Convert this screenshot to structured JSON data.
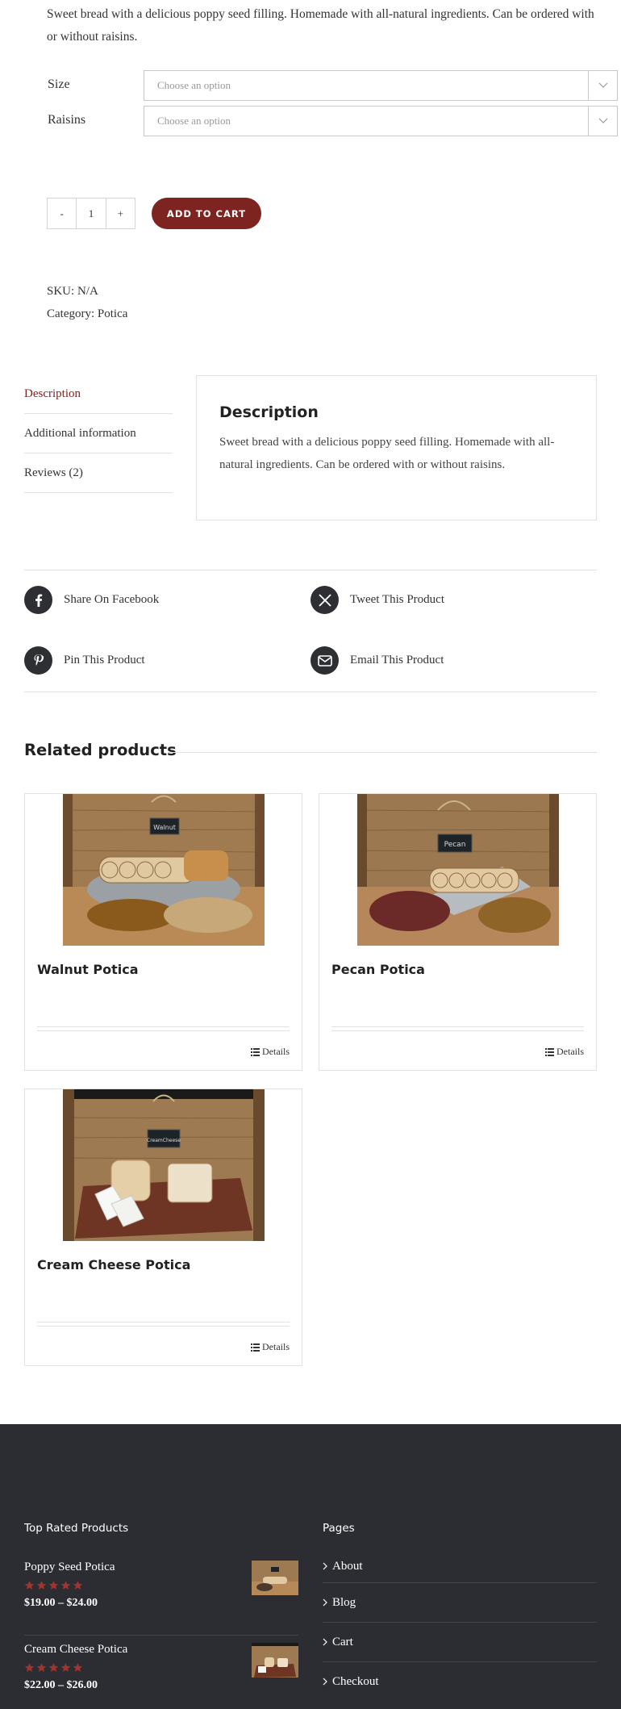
{
  "product": {
    "short_description": "Sweet bread with a delicious poppy seed filling. Homemade with all-natural ingredients. Can be ordered with or without raisins.",
    "variations": [
      {
        "label": "Size",
        "placeholder": "Choose an option"
      },
      {
        "label": "Raisins",
        "placeholder": "Choose an option"
      }
    ],
    "quantity": {
      "minus": "-",
      "value": "1",
      "plus": "+"
    },
    "add_to_cart": "ADD TO CART",
    "sku_label": "SKU:",
    "sku_value": "N/A",
    "category_label": "Category:",
    "category_value": "Potica"
  },
  "tabs": {
    "items": [
      "Description",
      "Additional information",
      "Reviews (2)"
    ],
    "active": "Description",
    "panel_title": "Description",
    "panel_text": "Sweet bread with a delicious poppy seed filling. Homemade with all-natural ingredients. Can be ordered with or without raisins."
  },
  "share": {
    "facebook": "Share On Facebook",
    "twitter": "Tweet This Product",
    "pinterest": "Pin This Product",
    "email": "Email This Product"
  },
  "related": {
    "title": "Related products",
    "products": [
      {
        "name": "Walnut Potica",
        "details": "Details",
        "sign": "Walnut"
      },
      {
        "name": "Pecan Potica",
        "details": "Details",
        "sign": "Pecan"
      },
      {
        "name": "Cream Cheese Potica",
        "details": "Details",
        "sign": "CreamCheese"
      }
    ]
  },
  "footer": {
    "top_rated_title": "Top Rated Products",
    "top_rated": [
      {
        "name": "Poppy Seed Potica",
        "price": "$19.00 – $24.00",
        "rating": 5
      },
      {
        "name": "Cream Cheese Potica",
        "price": "$22.00 – $26.00",
        "rating": 5
      }
    ],
    "pages_title": "Pages",
    "pages": [
      "About",
      "Blog",
      "Cart",
      "Checkout"
    ]
  },
  "colors": {
    "accent": "#7d2320",
    "footer_bg": "#2c2d33",
    "icon_circle": "#2e2f33"
  },
  "icons": {
    "facebook": "facebook-icon",
    "twitter": "x-twitter-icon",
    "pinterest": "pinterest-icon",
    "email": "envelope-icon",
    "details": "list-icon",
    "chevron": "chevron-down-icon",
    "star": "star-icon"
  }
}
